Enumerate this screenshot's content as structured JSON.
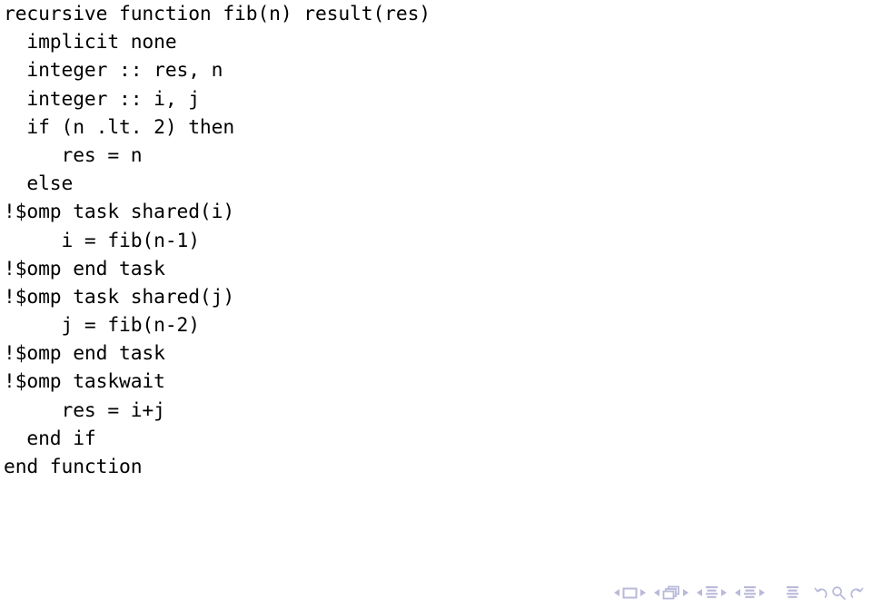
{
  "slide": {
    "kind": "beamer-slide",
    "background_color": "#ffffff",
    "text_color": "#000000"
  },
  "code": {
    "language": "fortran",
    "lines": [
      "recursive function fib(n) result(res)",
      "  implicit none",
      "  integer :: res, n",
      "  integer :: i, j",
      "  if (n .lt. 2) then",
      "     res = n",
      "  else",
      "!$omp task shared(i)",
      "     i = fib(n-1)",
      "!$omp end task",
      "!$omp task shared(j)",
      "     j = fib(n-2)",
      "!$omp end task",
      "!$omp taskwait",
      "     res = i+j",
      "  end if",
      "end function"
    ]
  },
  "navigation": {
    "icon_color": "#b9b9da",
    "groups": [
      {
        "name": "frame-navigation",
        "icon": "frame-icon",
        "prev_label": "Previous frame",
        "next_label": "Next frame"
      },
      {
        "name": "slide-deck-navigation",
        "icon": "slides-stack-icon",
        "prev_label": "Previous slide",
        "next_label": "Next slide"
      },
      {
        "name": "subsection-navigation",
        "icon": "subsection-icon",
        "prev_label": "Previous subsection",
        "next_label": "Next subsection"
      },
      {
        "name": "section-navigation",
        "icon": "section-icon",
        "prev_label": "Previous section",
        "next_label": "Next section"
      }
    ],
    "presentation_icon": {
      "name": "presentation-icon",
      "label": "Presentation overview"
    },
    "history": [
      {
        "name": "back-icon",
        "label": "Back"
      },
      {
        "name": "search-icon",
        "label": "Search"
      },
      {
        "name": "forward-icon",
        "label": "Forward"
      }
    ]
  }
}
